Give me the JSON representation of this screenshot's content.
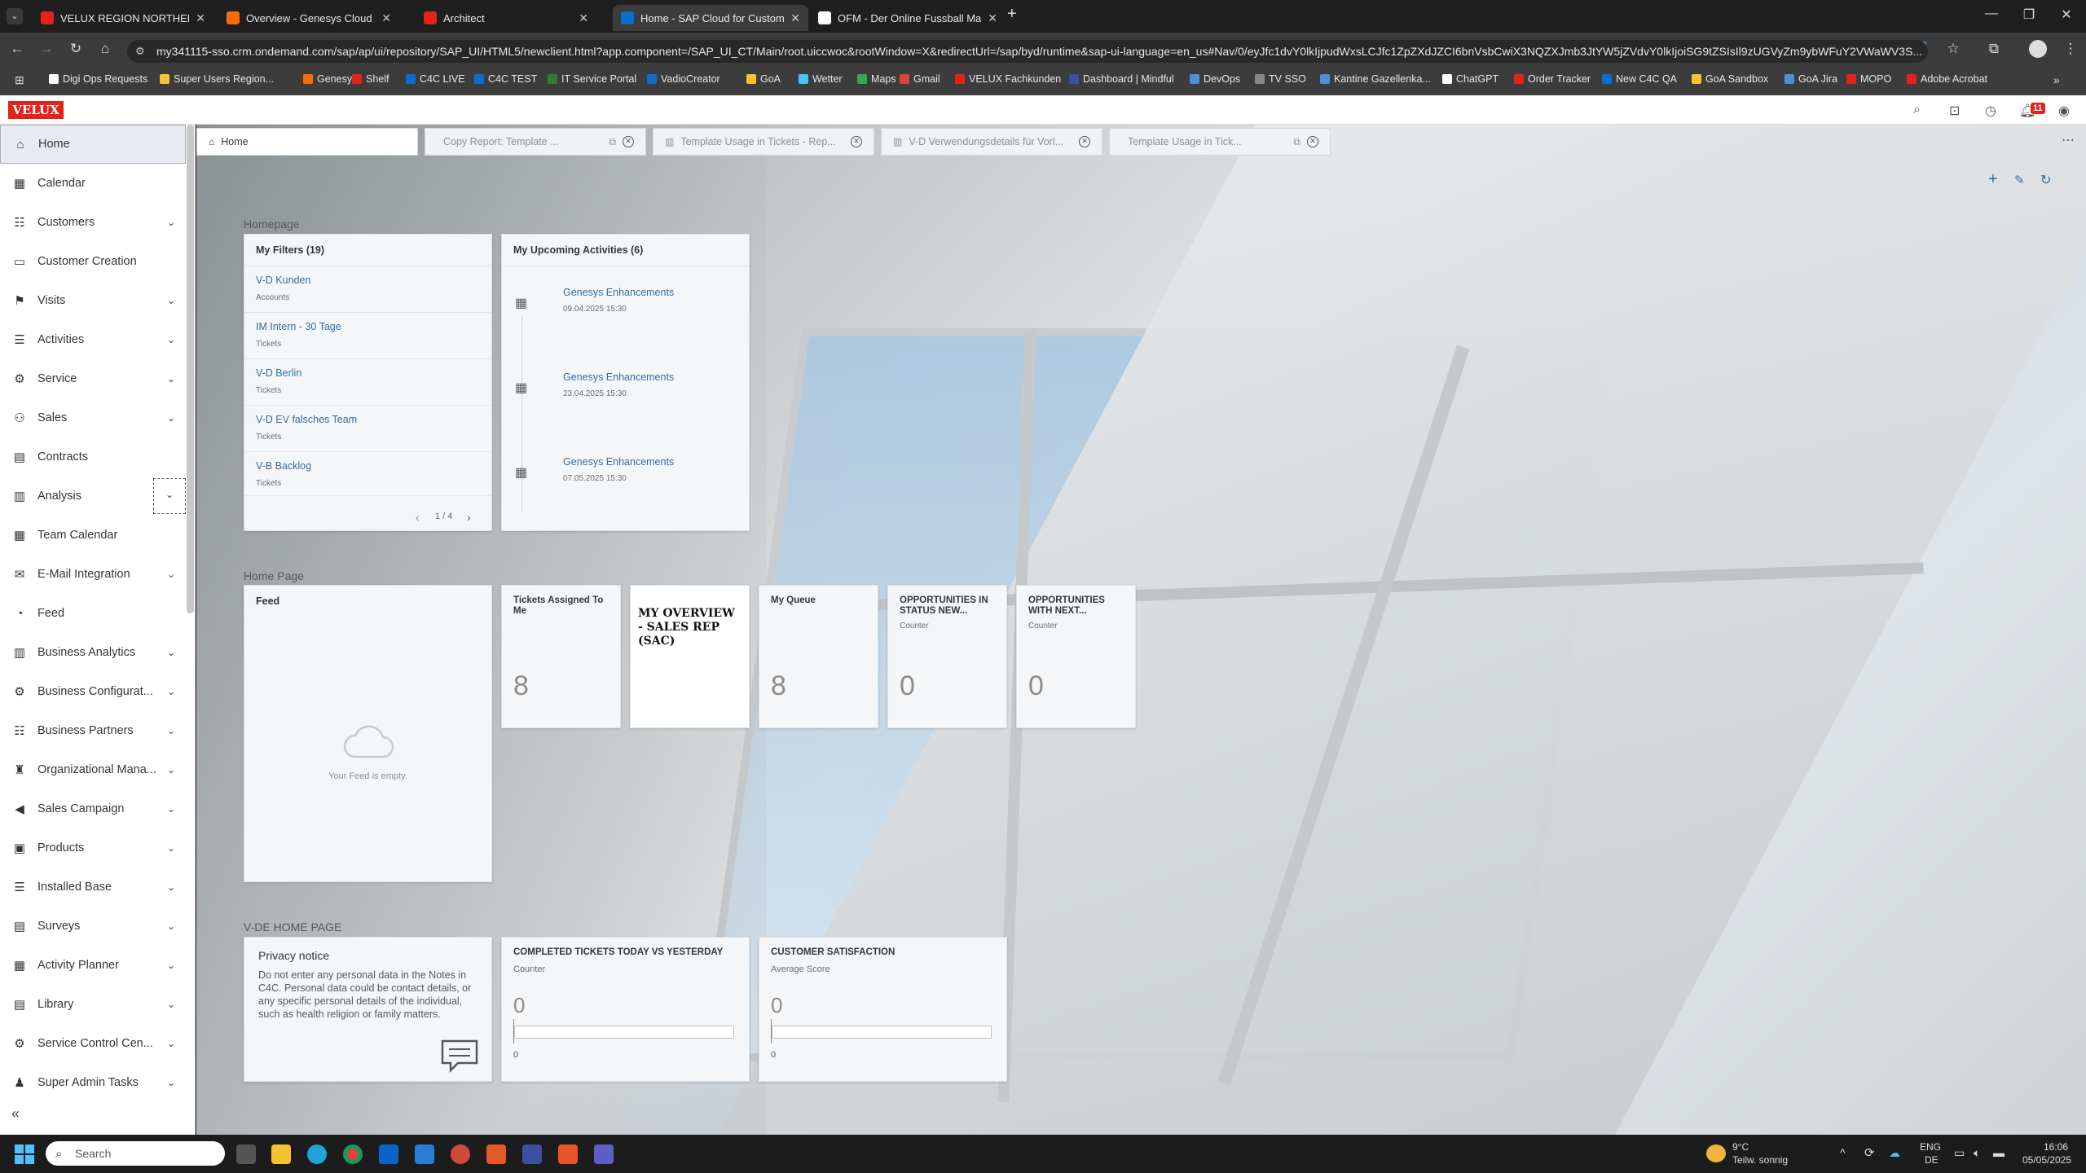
{
  "browser": {
    "tabs": [
      {
        "title": "VELUX REGION NORTHERN EU",
        "active": false,
        "color": "#e2231a"
      },
      {
        "title": "Overview - Genesys Cloud Adm",
        "active": false,
        "color": "#ff6b00"
      },
      {
        "title": "Architect",
        "active": false,
        "color": "#e2231a"
      },
      {
        "title": "Home - SAP Cloud for Custome",
        "active": true,
        "color": "#0a6ed1"
      },
      {
        "title": "OFM - Der Online Fussball Man",
        "active": false,
        "color": "#ffffff"
      }
    ],
    "new_tab": "+",
    "url": "my341115-sso.crm.ondemand.com/sap/ap/ui/repository/SAP_UI/HTML5/newclient.html?app.component=/SAP_UI_CT/Main/root.uiccwoc&rootWindow=X&redirectUrl=/sap/byd/runtime&sap-ui-language=en_us#Nav/0/eyJfc1dvY0lkIjpudWxsLCJfc1ZpZXdJZCI6bnVsbCwiX3NQZXJmb3JtYW5jZVdvY0lkIjoiSG9tZSIsIl9zUGVyZm9ybWFuY2VWaWV3S...",
    "bookmarks": [
      "Digi Ops Requests",
      "Super Users Region...",
      "Genesys",
      "Shelf",
      "C4C LIVE",
      "C4C TEST",
      "IT Service Portal",
      "VadioCreator",
      "GoA",
      "Wetter",
      "Maps",
      "Gmail",
      "VELUX Fachkunden",
      "Dashboard | Mindful",
      "DevOps",
      "TV SSO",
      "Kantine Gazellenka...",
      "ChatGPT",
      "Order Tracker",
      "New C4C QA",
      "GoA Sandbox",
      "GoA Jira",
      "MOPO",
      "Adobe Acrobat"
    ]
  },
  "shell": {
    "logo": "VELUX",
    "notification_count": "11"
  },
  "sidebar": {
    "items": [
      {
        "label": "Home",
        "icon": "home-icon",
        "glyph": "⌂",
        "chevron": false,
        "selected": true
      },
      {
        "label": "Calendar",
        "icon": "calendar-icon",
        "glyph": "▦",
        "chevron": false
      },
      {
        "label": "Customers",
        "icon": "customers-icon",
        "glyph": "☷",
        "chevron": true
      },
      {
        "label": "Customer Creation",
        "icon": "customer-creation-icon",
        "glyph": "▭",
        "chevron": false
      },
      {
        "label": "Visits",
        "icon": "visits-icon",
        "glyph": "⚑",
        "chevron": true
      },
      {
        "label": "Activities",
        "icon": "activities-icon",
        "glyph": "☰",
        "chevron": true
      },
      {
        "label": "Service",
        "icon": "service-icon",
        "glyph": "⚙",
        "chevron": true
      },
      {
        "label": "Sales",
        "icon": "sales-icon",
        "glyph": "⚇",
        "chevron": true
      },
      {
        "label": "Contracts",
        "icon": "contracts-icon",
        "glyph": "▤",
        "chevron": false
      },
      {
        "label": "Analysis",
        "icon": "analysis-icon",
        "glyph": "▥",
        "chevron": true,
        "focused": true
      },
      {
        "label": "Team Calendar",
        "icon": "team-calendar-icon",
        "glyph": "▦",
        "chevron": false
      },
      {
        "label": "E-Mail Integration",
        "icon": "email-icon",
        "glyph": "✉",
        "chevron": true
      },
      {
        "label": "Feed",
        "icon": "feed-icon",
        "glyph": "◔",
        "chevron": false
      },
      {
        "label": "Business Analytics",
        "icon": "business-analytics-icon",
        "glyph": "▥",
        "chevron": true
      },
      {
        "label": "Business Configurat...",
        "icon": "business-config-icon",
        "glyph": "⚙",
        "chevron": true
      },
      {
        "label": "Business Partners",
        "icon": "business-partners-icon",
        "glyph": "☷",
        "chevron": true
      },
      {
        "label": "Organizational Mana...",
        "icon": "org-management-icon",
        "glyph": "♜",
        "chevron": true
      },
      {
        "label": "Sales Campaign",
        "icon": "sales-campaign-icon",
        "glyph": "◀",
        "chevron": true
      },
      {
        "label": "Products",
        "icon": "products-icon",
        "glyph": "▣",
        "chevron": true
      },
      {
        "label": "Installed Base",
        "icon": "installed-base-icon",
        "glyph": "☰",
        "chevron": true
      },
      {
        "label": "Surveys",
        "icon": "surveys-icon",
        "glyph": "▤",
        "chevron": true
      },
      {
        "label": "Activity Planner",
        "icon": "activity-planner-icon",
        "glyph": "▦",
        "chevron": true
      },
      {
        "label": "Library",
        "icon": "library-icon",
        "glyph": "▤",
        "chevron": true
      },
      {
        "label": "Service Control Cen...",
        "icon": "service-control-icon",
        "glyph": "⚙",
        "chevron": true
      },
      {
        "label": "Super Admin Tasks",
        "icon": "super-admin-icon",
        "glyph": "♟",
        "chevron": true
      }
    ],
    "collapse": "«"
  },
  "content_tabs": [
    {
      "title": "Home",
      "active": true,
      "pin": false
    },
    {
      "title": "Copy Report: Template ...",
      "active": false,
      "pin": true
    },
    {
      "title": "Template Usage in Tickets - Rep...",
      "active": false,
      "pin": false
    },
    {
      "title": "V-D Verwendungsdetails für Vorl...",
      "active": false,
      "pin": false
    },
    {
      "title": "Template Usage in Tick...",
      "active": false,
      "pin": true
    }
  ],
  "homepage": {
    "section1_title": "Homepage",
    "filters": {
      "title": "My Filters (19)",
      "items": [
        {
          "name": "V-D Kunden",
          "type": "Accounts"
        },
        {
          "name": "IM Intern - 30 Tage",
          "type": "Tickets"
        },
        {
          "name": "V-D Berlin",
          "type": "Tickets"
        },
        {
          "name": "V-D EV falsches Team",
          "type": "Tickets"
        },
        {
          "name": "V-B Backlog",
          "type": "Tickets"
        }
      ],
      "pager": "1 / 4"
    },
    "activities": {
      "title": "My Upcoming Activities (6)",
      "items": [
        {
          "name": "Genesys Enhancements",
          "date": "09.04.2025 15:30"
        },
        {
          "name": "Genesys Enhancements",
          "date": "23.04.2025 15:30"
        },
        {
          "name": "Genesys Enhancements",
          "date": "07.05.2025 15:30"
        }
      ]
    },
    "section2_title": "Home Page",
    "feed": {
      "title": "Feed",
      "empty_text": "Your Feed is empty."
    },
    "tiles": [
      {
        "title": "Tickets Assigned To Me",
        "sub": "",
        "value": "8"
      },
      {
        "title": "MY OVERVIEW - SALES REP (SAC)",
        "sub": "",
        "value": ""
      },
      {
        "title": "My Queue",
        "sub": "",
        "value": "8"
      },
      {
        "title": "OPPORTUNITIES IN STATUS NEW...",
        "sub": "Counter",
        "value": "0"
      },
      {
        "title": "OPPORTUNITIES WITH NEXT...",
        "sub": "Counter",
        "value": "0"
      }
    ],
    "section3_title": "V-DE HOME PAGE",
    "privacy": {
      "title": "Privacy notice",
      "text": "Do not enter any personal data in the Notes in C4C. Personal data could be contact details, or any specific personal details of the individual, such as health religion or family matters."
    },
    "completed": {
      "title": "COMPLETED TICKETS TODAY VS YESTERDAY",
      "sub": "Counter",
      "value": "0",
      "axis": "0"
    },
    "satisfaction": {
      "title": "CUSTOMER SATISFACTION",
      "sub": "Average Score",
      "value": "0",
      "axis": "0"
    }
  },
  "taskbar": {
    "search_placeholder": "Search",
    "weather_temp": "9°C",
    "weather_text": "Teilw. sonnig",
    "lang1": "ENG",
    "lang2": "DE",
    "time": "16:06",
    "date": "05/05/2025"
  }
}
